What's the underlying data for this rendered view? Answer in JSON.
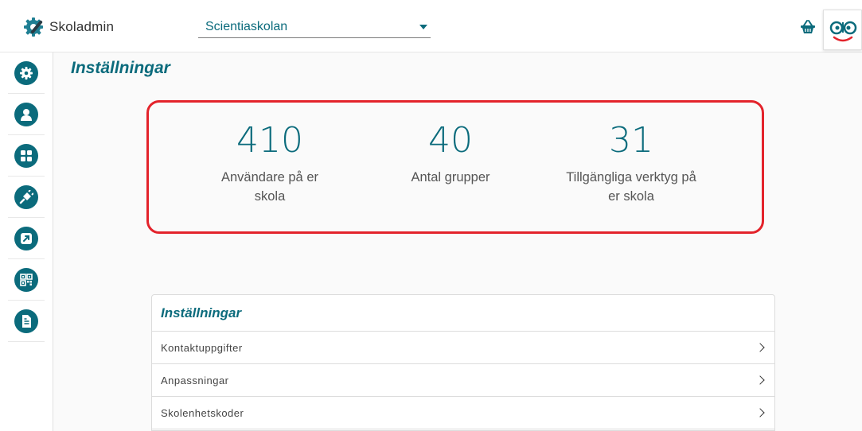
{
  "app": {
    "name": "Skoladmin"
  },
  "header": {
    "school_select": {
      "value": "Scientiaskolan"
    }
  },
  "sidebar": {
    "items": [
      {
        "icon": "gear-icon"
      },
      {
        "icon": "user-icon"
      },
      {
        "icon": "grid-icon"
      },
      {
        "icon": "plug-icon"
      },
      {
        "icon": "external-link-icon"
      },
      {
        "icon": "qr-code-icon"
      },
      {
        "icon": "document-icon"
      }
    ]
  },
  "page": {
    "title": "Inställningar"
  },
  "stats": [
    {
      "value": "410",
      "label": "Användare på er skola"
    },
    {
      "value": "40",
      "label": "Antal grupper"
    },
    {
      "value": "31",
      "label": "Tillgängliga verktyg på er skola"
    }
  ],
  "settings": {
    "heading": "Inställningar",
    "rows": [
      {
        "label": "Kontaktuppgifter"
      },
      {
        "label": "Anpassningar"
      },
      {
        "label": "Skolenhetskoder"
      }
    ]
  },
  "colors": {
    "accent": "#0b6b7c",
    "highlight_border": "#e3232b",
    "mascot_smile": "#e3232b"
  }
}
